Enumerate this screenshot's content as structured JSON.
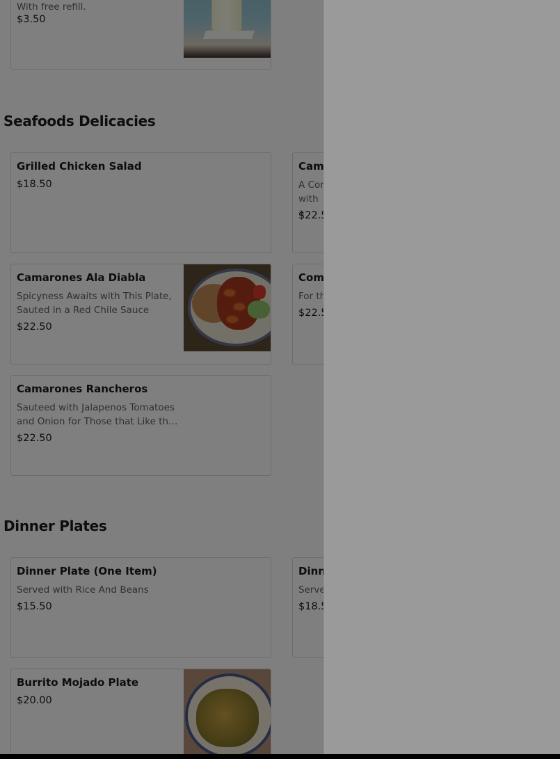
{
  "sections": {
    "drinks": {
      "items": [
        {
          "name": "",
          "desc": "With free refill.",
          "price": "$3.50"
        }
      ]
    },
    "seafood": {
      "title": "Seafoods Delicacies",
      "items": [
        {
          "name": "Grilled Chicken Salad",
          "price": "$18.50"
        },
        {
          "name": "Cama",
          "desc_line1": "A Cor",
          "desc_line2": "with a",
          "price": "$22.5"
        },
        {
          "name": "Camarones Ala Diabla",
          "desc": "Spicyness Awaits with This Plate, Sauted in a Red Chile Sauce",
          "price": "$22.50"
        },
        {
          "name": "Com",
          "desc": "For th",
          "price": "$22.5"
        },
        {
          "name": "Camarones Rancheros",
          "desc": "Sauteed with Jalapenos Tomatoes and Onion for Those that Like the Heat",
          "price": "$22.50"
        }
      ]
    },
    "dinner": {
      "title": "Dinner Plates",
      "items": [
        {
          "name": "Dinner Plate (One Item)",
          "desc": "Served with Rice And Beans",
          "price": "$15.50"
        },
        {
          "name": "Dinne",
          "desc": "Serve",
          "price": "$18.50"
        },
        {
          "name": "Burrito Mojado Plate",
          "price": "$20.00"
        }
      ]
    }
  },
  "colors": {
    "overlay": "rgba(0,0,0,0.5)",
    "panel": "#9a9a9a",
    "text": "#1a1a1a",
    "muted": "#5f5f5f",
    "border": "#d9d9d9"
  }
}
